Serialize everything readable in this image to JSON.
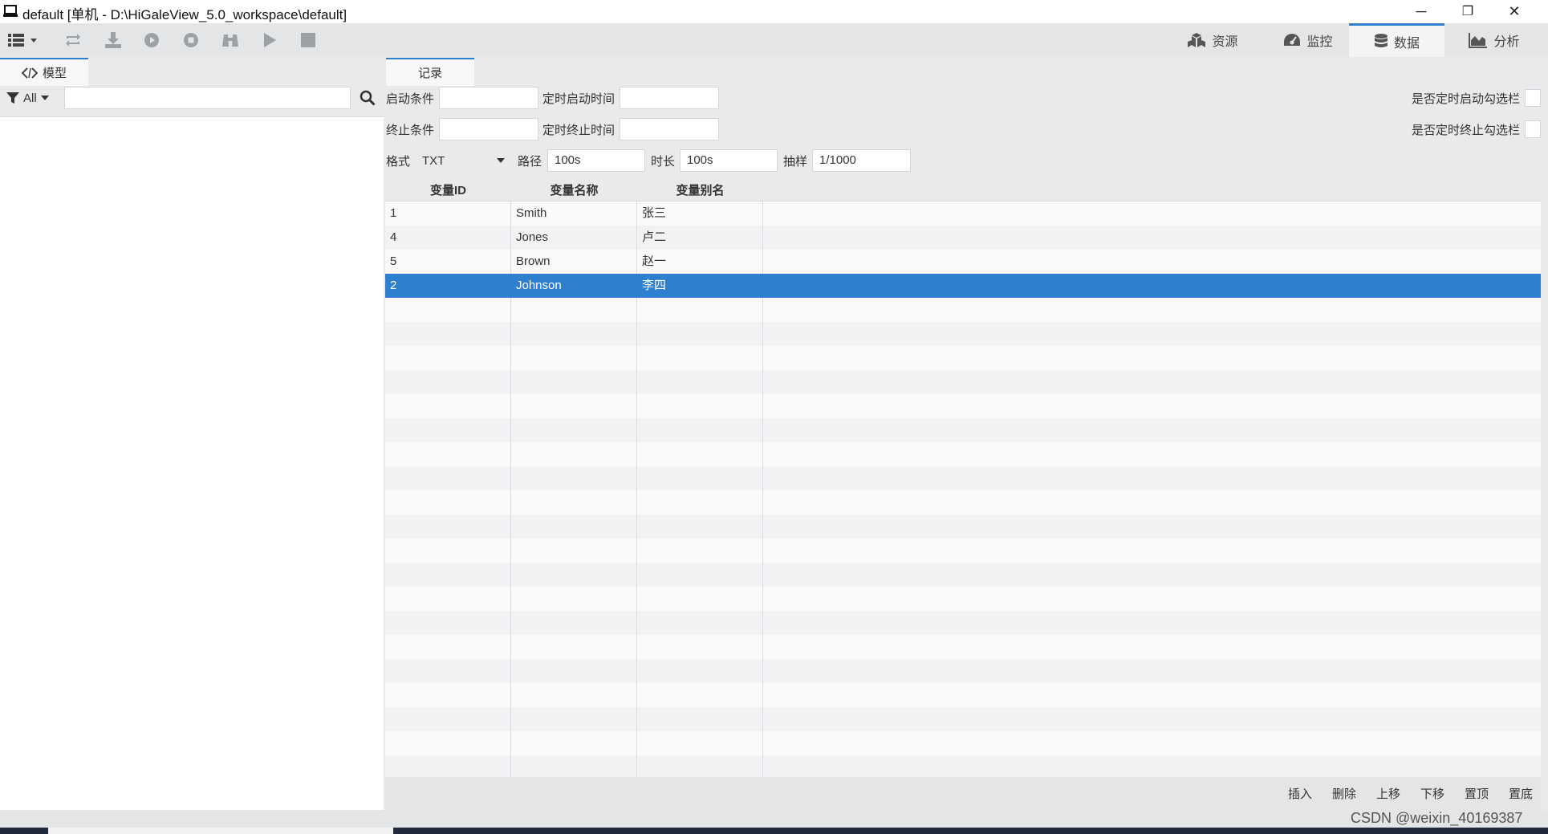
{
  "window": {
    "title": "default [单机 - D:\\HiGaleView_5.0_workspace\\default]",
    "minimize": "─",
    "maximize": "❐",
    "close": "✕"
  },
  "toolbar": {
    "icons": [
      "menu-icon",
      "refresh-icon",
      "download-icon",
      "play-circle-icon",
      "stop-circle-icon",
      "binoculars-icon",
      "play-icon",
      "stop-icon"
    ],
    "nav_tabs": [
      {
        "label": "资源",
        "icon": "cubes-icon"
      },
      {
        "label": "监控",
        "icon": "dashboard-icon"
      },
      {
        "label": "数据",
        "icon": "database-icon",
        "active": true
      },
      {
        "label": "分析",
        "icon": "area-chart-icon"
      }
    ]
  },
  "left_panel": {
    "tab_label": "模型",
    "filter_label": "All",
    "search_value": ""
  },
  "record_panel": {
    "tab_label": "记录",
    "start_condition_label": "启动条件",
    "start_condition_value": "",
    "scheduled_start_label": "定时启动时间",
    "scheduled_start_value": "",
    "stop_condition_label": "终止条件",
    "stop_condition_value": "",
    "scheduled_stop_label": "定时终止时间",
    "scheduled_stop_value": "",
    "scheduled_start_check_label": "是否定时启动勾选栏",
    "scheduled_stop_check_label": "是否定时终止勾选栏",
    "format_label": "格式",
    "format_value": "TXT",
    "path_label": "路径",
    "path_value": "100s",
    "duration_label": "时长",
    "duration_value": "100s",
    "sampling_label": "抽样",
    "sampling_value": "1/1000"
  },
  "table": {
    "columns": [
      "变量ID",
      "变量名称",
      "变量别名"
    ],
    "rows": [
      {
        "id": "1",
        "name": "Smith",
        "alias": "张三"
      },
      {
        "id": "4",
        "name": "Jones",
        "alias": "卢二"
      },
      {
        "id": "5",
        "name": "Brown",
        "alias": "赵一"
      },
      {
        "id": "2",
        "name": "Johnson",
        "alias": "李四",
        "selected": true
      }
    ],
    "selected_color": "#2f7fd1"
  },
  "footer_buttons": [
    "插入",
    "删除",
    "上移",
    "下移",
    "置顶",
    "置底"
  ],
  "watermark": "CSDN @weixin_40169387"
}
